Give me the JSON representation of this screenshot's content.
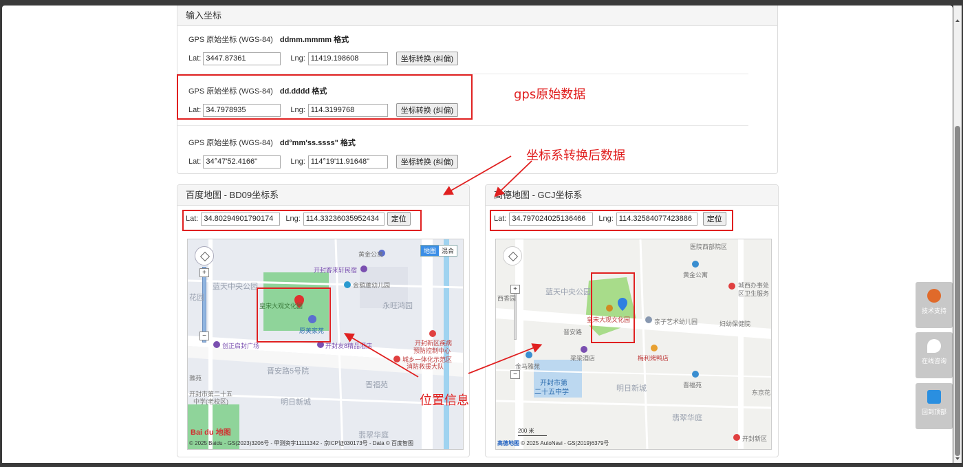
{
  "input_panel": {
    "heading": "输入坐标",
    "rows": [
      {
        "title": "GPS 原始坐标 (WGS-84)",
        "format": "ddmm.mmmm 格式",
        "lat_label": "Lat:",
        "lat": "3447.87361",
        "lng_label": "Lng:",
        "lng": "11419.198608",
        "button": "坐标转换 (纠偏)"
      },
      {
        "title": "GPS 原始坐标 (WGS-84)",
        "format": "dd.dddd 格式",
        "lat_label": "Lat:",
        "lat": "34.7978935",
        "lng_label": "Lng:",
        "lng": "114.3199768",
        "button": "坐标转换 (纠偏)"
      },
      {
        "title": "GPS 原始坐标 (WGS-84)",
        "format": "dd°mm'ss.ssss\" 格式",
        "lat_label": "Lat:",
        "lat": "34°47'52.4166\"",
        "lng_label": "Lng:",
        "lng": "114°19'11.91648\"",
        "button": "坐标转换 (纠偏)"
      }
    ]
  },
  "baidu_panel": {
    "heading": "百度地图 - BD09坐标系",
    "lat_label": "Lat:",
    "lat": "34.80294901790174",
    "lng_label": "Lng:",
    "lng": "114.33236035952434",
    "locate_button": "定位",
    "map": {
      "toggle_map": "地图",
      "toggle_hybrid": "混合",
      "labels": [
        "黄金公寓",
        "开封客来轩民宿",
        "金葫蘆幼儿园",
        "蓝天中央公园",
        "花园",
        "永旺鸿园",
        "皇宋大观文化园",
        "愿美家苑",
        "创正启封广场",
        "开封友8精品酒店",
        "开封新区疾病",
        "预防控制中心",
        "城乡一体化示范区",
        "消防救援大队",
        "晋安路5号院",
        "晋福苑",
        "开封市第二十五",
        "中学(老校区)",
        "明日新城",
        "翡翠华庭",
        "雅苑"
      ],
      "logo": "Bai du 地图",
      "copyright": "© 2025 Baidu - GS(2023)3206号 - 甲测资字11111342 - 京ICP证030173号 - Data © 百度智图"
    }
  },
  "gaode_panel": {
    "heading": "高德地图 - GCJ坐标系",
    "lat_label": "Lat:",
    "lat": "34.797024025136466",
    "lng_label": "Lng:",
    "lng": "114.32584077423886",
    "locate_button": "定位",
    "map": {
      "labels": [
        "医院西部院区",
        "黄金公寓",
        "城西办事处",
        "区卫生服务",
        "蓝天中央公园",
        "西香园",
        "皇宋大观文化园",
        "亲子艺术幼儿园",
        "妇幼保健院",
        "晋安路",
        "金马雅苑",
        "梁梁酒店",
        "梅利烤鸭店",
        "开封市第",
        "二十五中学",
        "明日新城",
        "晋福苑",
        "东京花",
        "翡翠华庭",
        "开封新区"
      ],
      "scale": "200 米",
      "logo": "高德地图",
      "copyright": "© 2025 AutoNavi - GS(2019)6379号"
    }
  },
  "annotations": {
    "raw": "gps原始数据",
    "converted": "坐标系转换后数据",
    "position": "位置信息"
  },
  "side_buttons": [
    {
      "label": "技术支持",
      "icon": "monkey-icon"
    },
    {
      "label": "在线咨询",
      "icon": "chat-icon"
    },
    {
      "label": "回到顶部",
      "icon": "back-to-top-icon"
    }
  ],
  "colors": {
    "annotation_red": "#e02020",
    "baidu_marker": "#e03030",
    "gaode_marker": "#2f7fe0"
  }
}
